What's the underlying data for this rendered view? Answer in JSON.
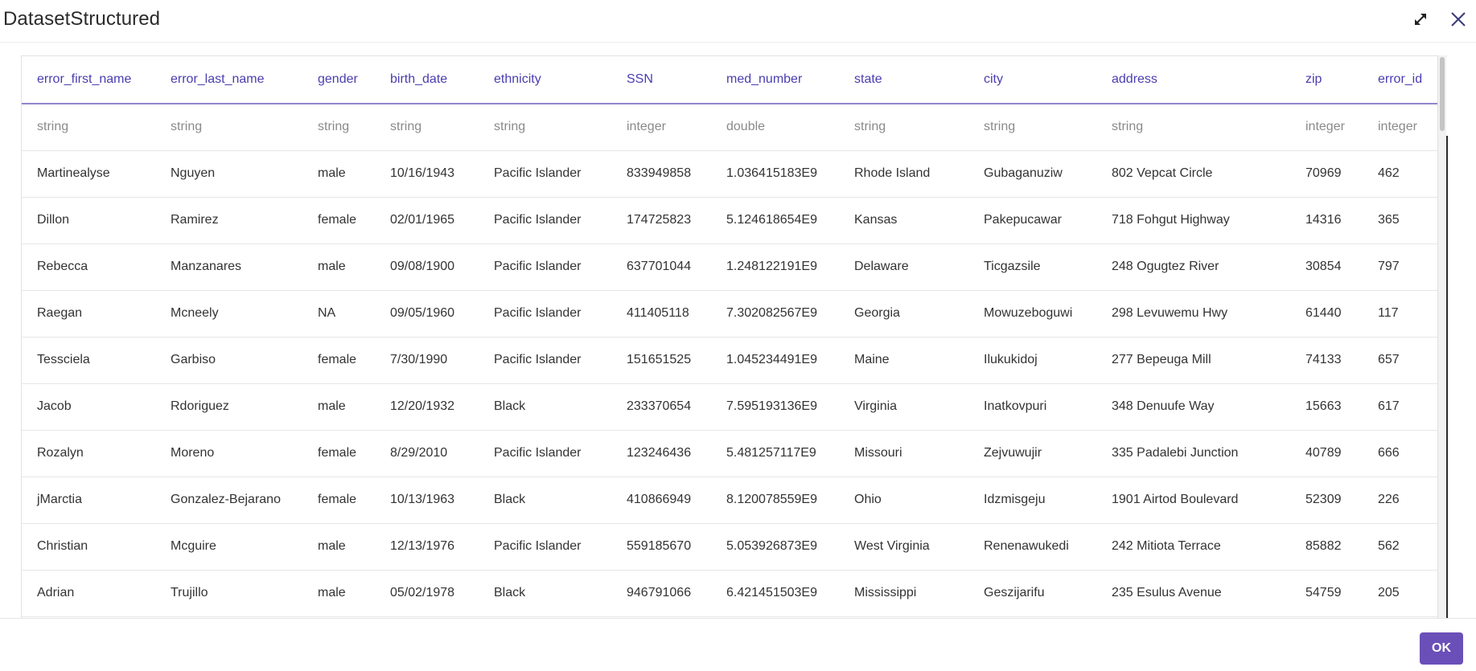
{
  "window": {
    "title": "DatasetStructured"
  },
  "icons": {
    "expand": "expand-arrows-icon",
    "close": "close-x-icon"
  },
  "colors": {
    "header_text": "#4a3db0",
    "header_rule": "#8e86cf",
    "type_text": "#8a8a8a",
    "ok_button": "#6a4fb8"
  },
  "table": {
    "columns": [
      "error_first_name",
      "error_last_name",
      "gender",
      "birth_date",
      "ethnicity",
      "SSN",
      "med_number",
      "state",
      "city",
      "address",
      "zip",
      "error_id"
    ],
    "types": [
      "string",
      "string",
      "string",
      "string",
      "string",
      "integer",
      "double",
      "string",
      "string",
      "string",
      "integer",
      "integer"
    ],
    "rows": [
      [
        "Martinealyse",
        "Nguyen",
        "male",
        "10/16/1943",
        "Pacific Islander",
        "833949858",
        "1.036415183E9",
        "Rhode Island",
        "Gubaganuziw",
        "802 Vepcat Circle",
        "70969",
        "462"
      ],
      [
        "Dillon",
        "Ramirez",
        "female",
        "02/01/1965",
        "Pacific Islander",
        "174725823",
        "5.124618654E9",
        "Kansas",
        "Pakepucawar",
        "718 Fohgut Highway",
        "14316",
        "365"
      ],
      [
        "Rebecca",
        "Manzanares",
        "male",
        "09/08/1900",
        "Pacific Islander",
        "637701044",
        "1.248122191E9",
        "Delaware",
        "Ticgazsile",
        "248 Ogugtez River",
        "30854",
        "797"
      ],
      [
        "Raegan",
        "Mcneely",
        "NA",
        "09/05/1960",
        "Pacific Islander",
        "411405118",
        "7.302082567E9",
        "Georgia",
        "Mowuzeboguwi",
        "298 Levuwemu Hwy",
        "61440",
        "117"
      ],
      [
        "Tessciela",
        "Garbiso",
        "female",
        "7/30/1990",
        "Pacific Islander",
        "151651525",
        "1.045234491E9",
        "Maine",
        "Ilukukidoj",
        "277 Bepeuga Mill",
        "74133",
        "657"
      ],
      [
        "Jacob",
        "Rdoriguez",
        "male",
        "12/20/1932",
        "Black",
        "233370654",
        "7.595193136E9",
        "Virginia",
        "Inatkovpuri",
        "348 Denuufe Way",
        "15663",
        "617"
      ],
      [
        "Rozalyn",
        "Moreno",
        "female",
        "8/29/2010",
        "Pacific Islander",
        "123246436",
        "5.481257117E9",
        "Missouri",
        "Zejvuwujir",
        "335 Padalebi Junction",
        "40789",
        "666"
      ],
      [
        "jMarctia",
        "Gonzalez-Bejarano",
        "female",
        "10/13/1963",
        "Black",
        "410866949",
        "8.120078559E9",
        "Ohio",
        "Idzmisgeju",
        "1901 Airtod Boulevard",
        "52309",
        "226"
      ],
      [
        "Christian",
        "Mcguire",
        "male",
        "12/13/1976",
        "Pacific Islander",
        "559185670",
        "5.053926873E9",
        "West Virginia",
        "Renenawukedi",
        "242 Mitiota Terrace",
        "85882",
        "562"
      ],
      [
        "Adrian",
        "Trujillo",
        "male",
        "05/02/1978",
        "Black",
        "946791066",
        "6.421451503E9",
        "Mississippi",
        "Geszijarifu",
        "235 Esulus Avenue",
        "54759",
        "205"
      ]
    ]
  },
  "footer": {
    "ok_label": "OK"
  }
}
